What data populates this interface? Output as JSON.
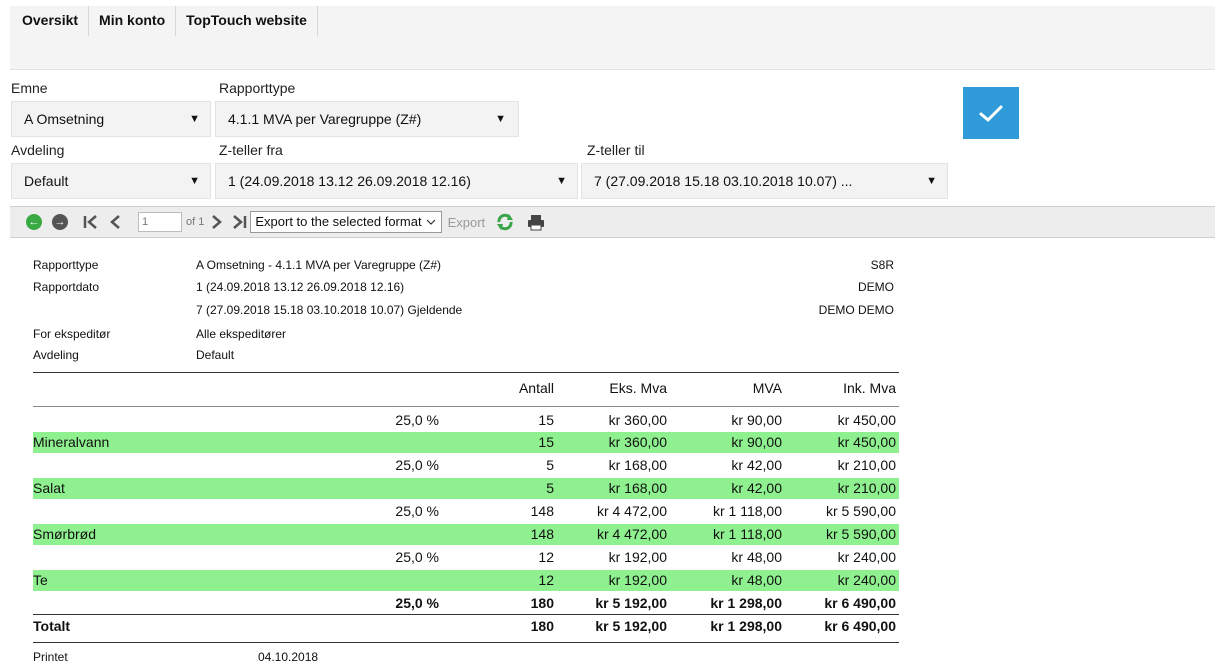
{
  "nav": {
    "tabs": [
      "Oversikt",
      "Min konto",
      "TopTouch website"
    ]
  },
  "form": {
    "emne_label": "Emne",
    "emne_value": "A Omsetning",
    "rapporttype_label": "Rapporttype",
    "rapporttype_value": "4.1.1 MVA per Varegruppe (Z#)",
    "avdeling_label": "Avdeling",
    "avdeling_value": "Default",
    "zfra_label": "Z-teller fra",
    "zfra_value": "1 (24.09.2018 13.12 26.09.2018 12.16)",
    "ztil_label": "Z-teller til",
    "ztil_value": "7 (27.09.2018 15.18 03.10.2018 10.07) ...",
    "dropdown_arrow": "▼",
    "confirm_icon": "checkmark-icon",
    "accent_color": "#2f9bd8"
  },
  "toolbar": {
    "page_value": "1",
    "of_pages": "of 1",
    "export_select": "Export to the selected format",
    "export_label": "Export"
  },
  "report": {
    "meta": {
      "rapporttype_label": "Rapporttype",
      "rapporttype_value": "A Omsetning - 4.1.1 MVA per Varegruppe (Z#)",
      "rapportdato_label": "Rapportdato",
      "rapportdato_value1": "1 (24.09.2018 13.12 26.09.2018 12.16)",
      "rapportdato_value2": "7 (27.09.2018 15.18 03.10.2018 10.07) Gjeldende",
      "ekspeditor_label": "For ekspeditør",
      "ekspeditor_value": "Alle ekspeditører",
      "avdeling_label": "Avdeling",
      "avdeling_value": "Default",
      "right1": "S8R",
      "right2": "DEMO",
      "right3": "DEMO DEMO"
    },
    "headers": {
      "antall": "Antall",
      "eks": "Eks. Mva",
      "mva": "MVA",
      "ink": "Ink. Mva"
    },
    "rows": [
      {
        "name": "",
        "pct": "25,0 %",
        "antall": "15",
        "eks": "kr 360,00",
        "mva": "kr 90,00",
        "ink": "kr 450,00"
      },
      {
        "name": "Mineralvann",
        "pct": "",
        "antall": "15",
        "eks": "kr 360,00",
        "mva": "kr 90,00",
        "ink": "kr 450,00"
      },
      {
        "name": "",
        "pct": "25,0 %",
        "antall": "5",
        "eks": "kr 168,00",
        "mva": "kr 42,00",
        "ink": "kr 210,00"
      },
      {
        "name": "Salat",
        "pct": "",
        "antall": "5",
        "eks": "kr 168,00",
        "mva": "kr 42,00",
        "ink": "kr 210,00"
      },
      {
        "name": "",
        "pct": "25,0 %",
        "antall": "148",
        "eks": "kr 4 472,00",
        "mva": "kr 1 118,00",
        "ink": "kr 5 590,00"
      },
      {
        "name": "Smørbrød",
        "pct": "",
        "antall": "148",
        "eks": "kr 4 472,00",
        "mva": "kr 1 118,00",
        "ink": "kr 5 590,00"
      },
      {
        "name": "",
        "pct": "25,0 %",
        "antall": "12",
        "eks": "kr 192,00",
        "mva": "kr 48,00",
        "ink": "kr 240,00"
      },
      {
        "name": "Te",
        "pct": "",
        "antall": "12",
        "eks": "kr 192,00",
        "mva": "kr 48,00",
        "ink": "kr 240,00"
      },
      {
        "name": "",
        "pct": "25,0 %",
        "antall": "180",
        "eks": "kr 5 192,00",
        "mva": "kr 1 298,00",
        "ink": "kr 6 490,00"
      },
      {
        "name": "Totalt",
        "pct": "",
        "antall": "180",
        "eks": "kr 5 192,00",
        "mva": "kr 1 298,00",
        "ink": "kr 6 490,00"
      }
    ],
    "highlight_color": "#8ef08e",
    "printet_label": "Printet",
    "printet_value": "04.10.2018"
  }
}
